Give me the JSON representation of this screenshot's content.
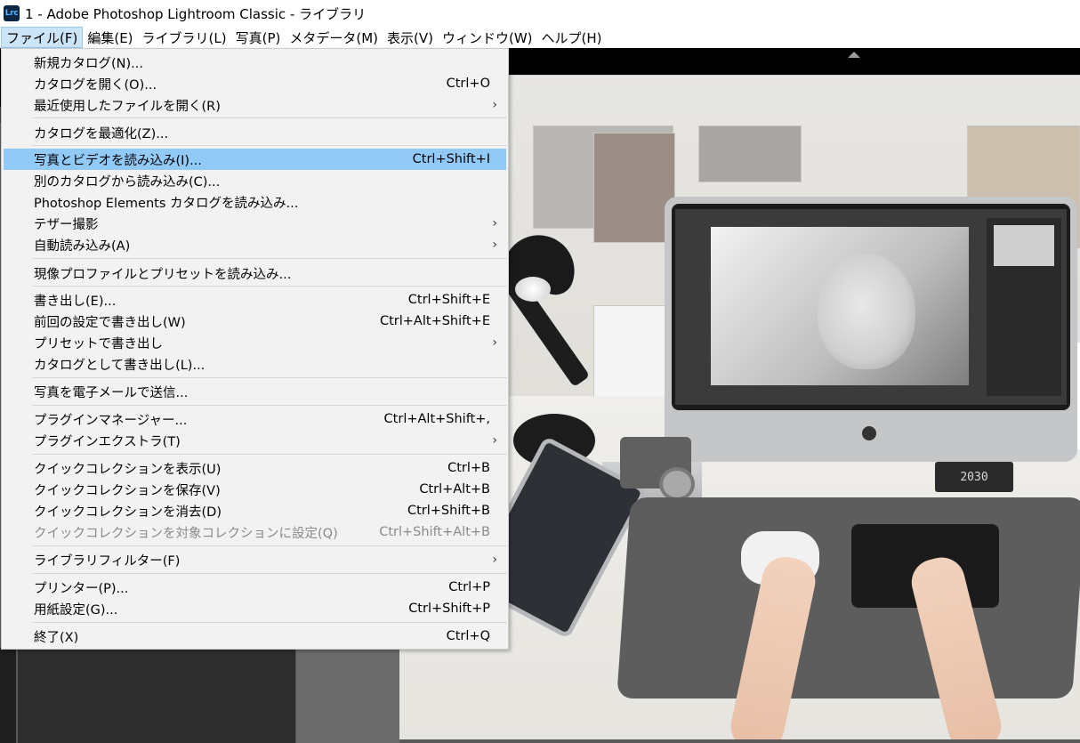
{
  "window": {
    "app_logo_text": "Lrc",
    "title": "1 - Adobe Photoshop Lightroom Classic - ライブラリ"
  },
  "menubar": {
    "items": [
      {
        "label": "ファイル(F)",
        "active": true
      },
      {
        "label": "編集(E)"
      },
      {
        "label": "ライブラリ(L)"
      },
      {
        "label": "写真(P)"
      },
      {
        "label": "メタデータ(M)"
      },
      {
        "label": "表示(V)"
      },
      {
        "label": "ウィンドウ(W)"
      },
      {
        "label": "ヘルプ(H)"
      }
    ]
  },
  "file_menu": {
    "items": [
      {
        "label": "新規カタログ(N)...",
        "shortcut": ""
      },
      {
        "label": "カタログを開く(O)...",
        "shortcut": "Ctrl+O"
      },
      {
        "label": "最近使用したファイルを開く(R)",
        "shortcut": "",
        "submenu": true
      },
      {
        "label": "カタログを最適化(Z)...",
        "shortcut": ""
      },
      {
        "label": "写真とビデオを読み込み(I)...",
        "shortcut": "Ctrl+Shift+I",
        "highlighted": true
      },
      {
        "label": "別のカタログから読み込み(C)...",
        "shortcut": ""
      },
      {
        "label": "Photoshop Elements カタログを読み込み...",
        "shortcut": ""
      },
      {
        "label": "テザー撮影",
        "shortcut": "",
        "submenu": true
      },
      {
        "label": "自動読み込み(A)",
        "shortcut": "",
        "submenu": true
      },
      {
        "label": "現像プロファイルとプリセットを読み込み...",
        "shortcut": ""
      },
      {
        "label": "書き出し(E)...",
        "shortcut": "Ctrl+Shift+E"
      },
      {
        "label": "前回の設定で書き出し(W)",
        "shortcut": "Ctrl+Alt+Shift+E"
      },
      {
        "label": "プリセットで書き出し",
        "shortcut": "",
        "submenu": true
      },
      {
        "label": "カタログとして書き出し(L)...",
        "shortcut": ""
      },
      {
        "label": "写真を電子メールで送信...",
        "shortcut": ""
      },
      {
        "label": "プラグインマネージャー...",
        "shortcut": "Ctrl+Alt+Shift+,"
      },
      {
        "label": "プラグインエクストラ(T)",
        "shortcut": "",
        "submenu": true
      },
      {
        "label": "クイックコレクションを表示(U)",
        "shortcut": "Ctrl+B"
      },
      {
        "label": "クイックコレクションを保存(V)",
        "shortcut": "Ctrl+Alt+B"
      },
      {
        "label": "クイックコレクションを消去(D)",
        "shortcut": "Ctrl+Shift+B"
      },
      {
        "label": "クイックコレクションを対象コレクションに設定(Q)",
        "shortcut": "Ctrl+Shift+Alt+B",
        "disabled": true
      },
      {
        "label": "ライブラリフィルター(F)",
        "shortcut": "",
        "submenu": true
      },
      {
        "label": "プリンター(P)...",
        "shortcut": "Ctrl+P"
      },
      {
        "label": "用紙設定(G)...",
        "shortcut": "Ctrl+Shift+P"
      },
      {
        "label": "終了(X)",
        "shortcut": "Ctrl+Q"
      }
    ]
  },
  "photo": {
    "clock_text": "2030",
    "subject": "desk-setup-photo"
  },
  "colors": {
    "menu_highlight": "#91c9f7",
    "menubar_active": "#cce4f7",
    "menu_background": "#f2f2f2",
    "disabled_text": "#8a8a8a",
    "lightroom_dark": "#000000"
  }
}
